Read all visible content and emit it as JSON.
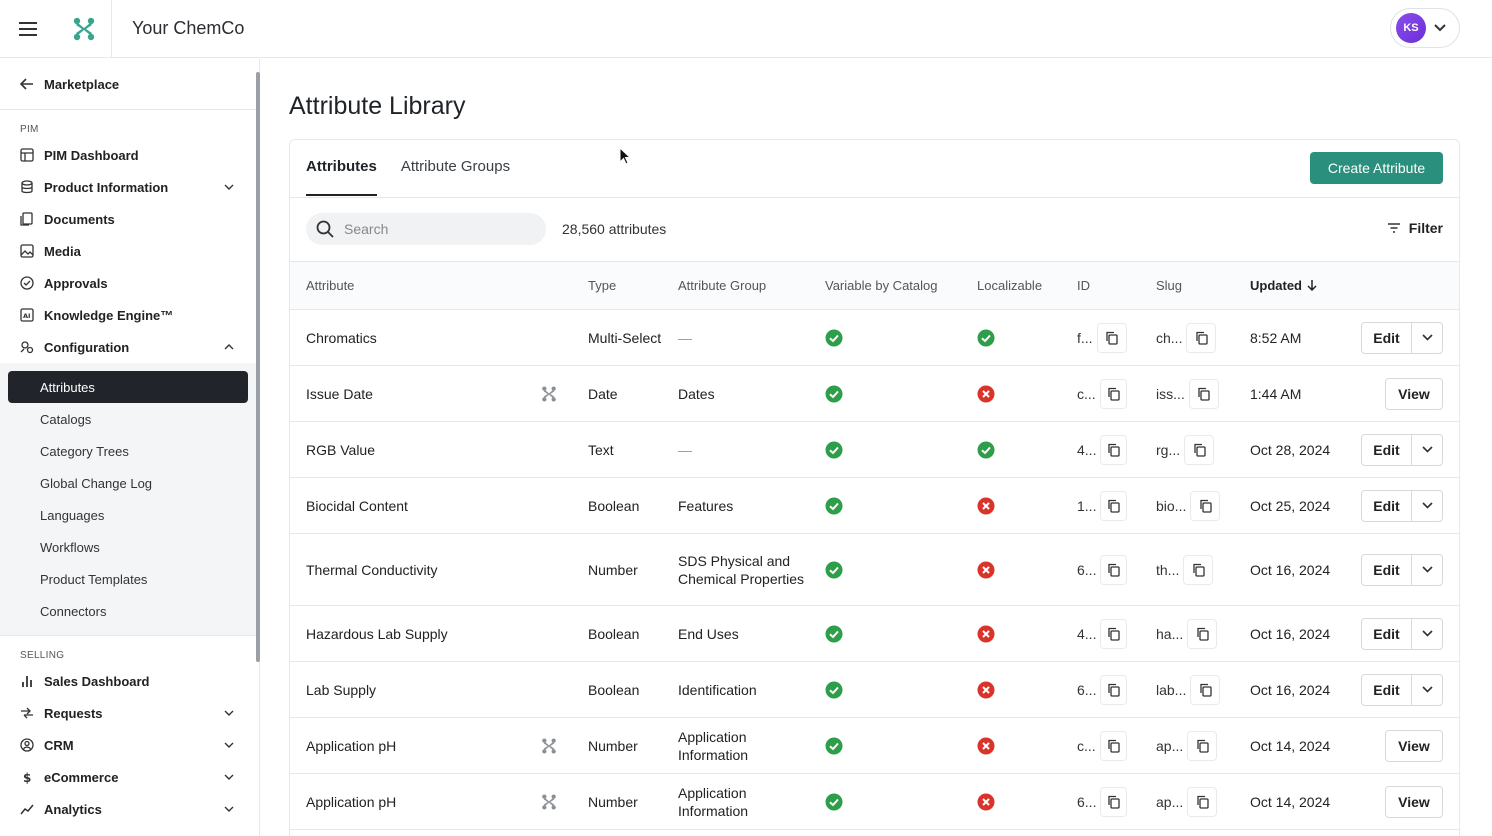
{
  "header": {
    "company": "Your ChemCo",
    "avatar_initials": "KS"
  },
  "sidebar": {
    "back": "Marketplace",
    "pim_label": "PIM",
    "pim_items": [
      {
        "label": "PIM Dashboard",
        "icon": "dashboard-icon"
      },
      {
        "label": "Product Information",
        "icon": "database-icon"
      },
      {
        "label": "Documents",
        "icon": "documents-icon"
      },
      {
        "label": "Media",
        "icon": "image-icon"
      },
      {
        "label": "Approvals",
        "icon": "check-circle-icon"
      },
      {
        "label": "Knowledge Engine™",
        "icon": "ai-icon"
      },
      {
        "label": "Configuration",
        "icon": "config-icon"
      }
    ],
    "config_items": [
      "Attributes",
      "Catalogs",
      "Category Trees",
      "Global Change Log",
      "Languages",
      "Workflows",
      "Product Templates",
      "Connectors"
    ],
    "selling_label": "SELLING",
    "selling_items": [
      {
        "label": "Sales Dashboard",
        "icon": "bar-chart-icon"
      },
      {
        "label": "Requests",
        "icon": "requests-icon"
      },
      {
        "label": "CRM",
        "icon": "user-circle-icon"
      },
      {
        "label": "eCommerce",
        "icon": "dollar-icon"
      },
      {
        "label": "Analytics",
        "icon": "trend-icon"
      }
    ]
  },
  "page": {
    "title": "Attribute Library",
    "tabs": [
      "Attributes",
      "Attribute Groups"
    ],
    "create_button": "Create Attribute",
    "search_placeholder": "Search",
    "count": "28,560 attributes",
    "filter": "Filter"
  },
  "table": {
    "columns": [
      "Attribute",
      "Type",
      "Attribute Group",
      "Variable by Catalog",
      "Localizable",
      "ID",
      "Slug",
      "Updated"
    ],
    "rows": [
      {
        "attribute": "Chromatics",
        "type": "Multi-Select",
        "group": "—",
        "variable": true,
        "localizable": true,
        "id": "f...",
        "slug": "ch...",
        "updated": "8:52 AM",
        "action": "Edit",
        "external": false
      },
      {
        "attribute": "Issue Date",
        "type": "Date",
        "group": "Dates",
        "variable": true,
        "localizable": false,
        "id": "c...",
        "slug": "iss...",
        "updated": "1:44 AM",
        "action": "View",
        "external": true
      },
      {
        "attribute": "RGB Value",
        "type": "Text",
        "group": "—",
        "variable": true,
        "localizable": true,
        "id": "4...",
        "slug": "rg...",
        "updated": "Oct 28, 2024",
        "action": "Edit",
        "external": false
      },
      {
        "attribute": "Biocidal Content",
        "type": "Boolean",
        "group": "Features",
        "variable": true,
        "localizable": false,
        "id": "1...",
        "slug": "bio...",
        "updated": "Oct 25, 2024",
        "action": "Edit",
        "external": false
      },
      {
        "attribute": "Thermal Conductivity",
        "type": "Number",
        "group": "SDS Physical and Chemical Properties",
        "variable": true,
        "localizable": false,
        "id": "6...",
        "slug": "th...",
        "updated": "Oct 16, 2024",
        "action": "Edit",
        "external": false
      },
      {
        "attribute": "Hazardous Lab Supply",
        "type": "Boolean",
        "group": "End Uses",
        "variable": true,
        "localizable": false,
        "id": "4...",
        "slug": "ha...",
        "updated": "Oct 16, 2024",
        "action": "Edit",
        "external": false
      },
      {
        "attribute": "Lab Supply",
        "type": "Boolean",
        "group": "Identification",
        "variable": true,
        "localizable": false,
        "id": "6...",
        "slug": "lab...",
        "updated": "Oct 16, 2024",
        "action": "Edit",
        "external": false
      },
      {
        "attribute": "Application pH",
        "type": "Number",
        "group": "Application Information",
        "variable": true,
        "localizable": false,
        "id": "c...",
        "slug": "ap...",
        "updated": "Oct 14, 2024",
        "action": "View",
        "external": true
      },
      {
        "attribute": "Application pH",
        "type": "Number",
        "group": "Application Information",
        "variable": true,
        "localizable": false,
        "id": "6...",
        "slug": "ap...",
        "updated": "Oct 14, 2024",
        "action": "View",
        "external": true
      }
    ]
  },
  "colors": {
    "accent": "#2b8f7e",
    "check": "#2e9e4a",
    "cross": "#d9342b",
    "active_nav": "#21252b"
  }
}
